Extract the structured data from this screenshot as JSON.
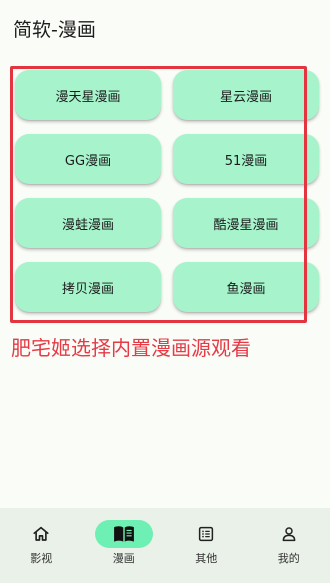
{
  "header": {
    "title": "简软-漫画"
  },
  "sources": [
    {
      "label": "漫天星漫画"
    },
    {
      "label": "星云漫画"
    },
    {
      "label": "GG漫画"
    },
    {
      "label": "51漫画"
    },
    {
      "label": "漫蛙漫画"
    },
    {
      "label": "酷漫星漫画"
    },
    {
      "label": "拷贝漫画"
    },
    {
      "label": "鱼漫画"
    }
  ],
  "annotation": {
    "text": "肥宅姬选择内置漫画源观看",
    "color": "#e53b47"
  },
  "nav": {
    "items": [
      {
        "label": "影视",
        "icon": "home-icon",
        "active": false
      },
      {
        "label": "漫画",
        "icon": "book-icon",
        "active": true
      },
      {
        "label": "其他",
        "icon": "list-icon",
        "active": false
      },
      {
        "label": "我的",
        "icon": "person-icon",
        "active": false
      }
    ]
  },
  "colors": {
    "button": "#a6f3cc",
    "active_tab": "#6ef0b4",
    "highlight": "#e3343f"
  }
}
